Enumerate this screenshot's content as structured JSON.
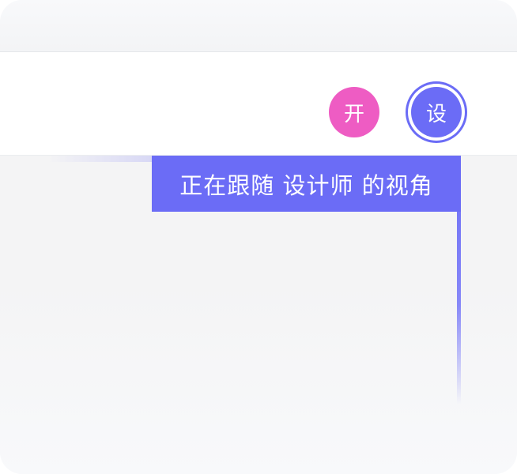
{
  "toolbar": {
    "avatars": [
      {
        "label": "开",
        "color": "#ee5cc3"
      },
      {
        "label": "设",
        "color": "#6b6cf6"
      }
    ]
  },
  "follow_banner": {
    "text": "正在跟随 设计师 的视角",
    "color": "#6b6cf6"
  }
}
